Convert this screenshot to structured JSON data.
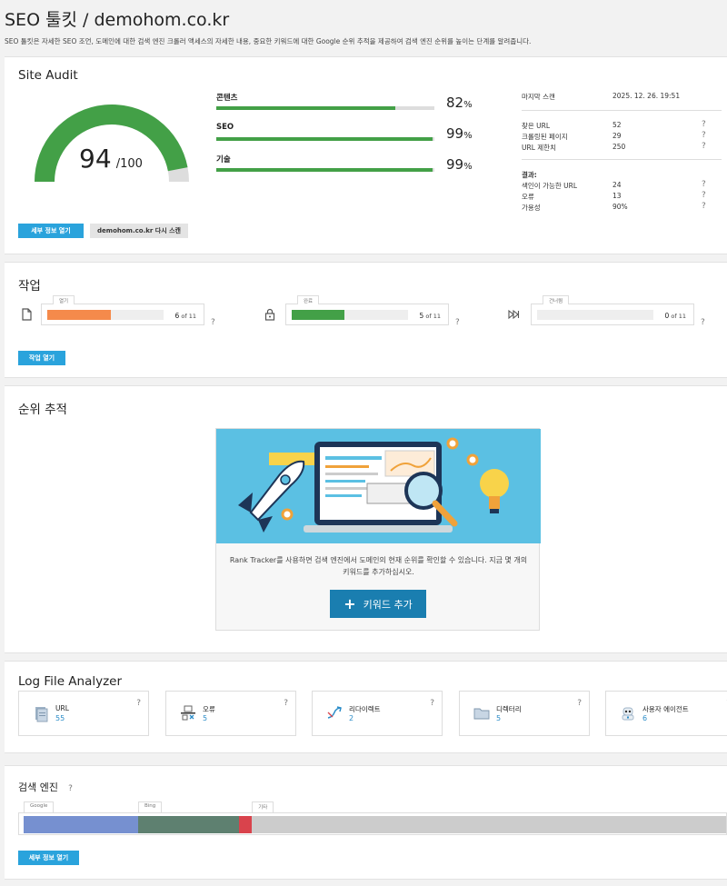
{
  "header": {
    "title": "SEO 툴킷 / demohom.co.kr",
    "description": "SEO 툴킷은 자세한 SEO 조언, 도메인에 대한 검색 엔진 크롤러 액세스의 자세한 내용, 중요한 키워드에 대한 Google 순위 추적을 제공하여 검색 엔진 순위를 높이는 단계를 알려줍니다."
  },
  "site_audit": {
    "title": "Site Audit",
    "score": "94",
    "score_max": "/100",
    "score_value": 94,
    "metrics": [
      {
        "label": "콘텐츠",
        "value": "82",
        "pct": "%",
        "fill": 82
      },
      {
        "label": "SEO",
        "value": "99",
        "pct": "%",
        "fill": 99
      },
      {
        "label": "기술",
        "value": "99",
        "pct": "%",
        "fill": 99
      }
    ],
    "last_scan_label": "마지막 스캔",
    "last_scan_value": "2025. 12. 26. 19:51",
    "stats": [
      {
        "label": "찾은 URL",
        "value": "52",
        "q": "?"
      },
      {
        "label": "크롤링된 페이지",
        "value": "29",
        "q": "?"
      },
      {
        "label": "URL 제한치",
        "value": "250",
        "q": "?"
      }
    ],
    "results_label": "결과:",
    "results": [
      {
        "label": "색인이 가능한 URL",
        "value": "24",
        "q": "?"
      },
      {
        "label": "오류",
        "value": "13",
        "q": "?"
      },
      {
        "label": "가용성",
        "value": "90%",
        "q": "?"
      }
    ],
    "details_button": "세부 정보 열기",
    "rescan_button": "demohom.co.kr 다시 스캔"
  },
  "tasks": {
    "title": "작업",
    "items": [
      {
        "tag": "열기",
        "count": "6",
        "of": "of 11",
        "fill": 0.545,
        "color": "#f58a4b",
        "q": "?"
      },
      {
        "tag": "완료",
        "count": "5",
        "of": "of 11",
        "fill": 0.455,
        "color": "#43a047",
        "q": "?"
      },
      {
        "tag": "건너뜀",
        "count": "0",
        "of": "of 11",
        "fill": 0,
        "color": "#bbbbbb",
        "q": "?"
      }
    ],
    "open_button": "작업 열기"
  },
  "rank_tracking": {
    "title": "순위 추적",
    "description": "Rank Tracker를 사용하면 검색 엔진에서 도메인의 현재 순위를 확인할 수 있습니다. 지금 몇 개의 키워드를 추가하십시오.",
    "add_button_icon": "+",
    "add_button": "키워드 추가"
  },
  "log_file": {
    "title": "Log File Analyzer",
    "items": [
      {
        "label": "URL",
        "value": "55",
        "icon": "document-icon",
        "q": "?"
      },
      {
        "label": "오류",
        "value": "5",
        "icon": "error-icon",
        "q": "?"
      },
      {
        "label": "리다이렉트",
        "value": "2",
        "icon": "redirect-icon",
        "q": "?"
      },
      {
        "label": "디렉터리",
        "value": "5",
        "icon": "folder-icon",
        "q": "?"
      },
      {
        "label": "사용자 에이전트",
        "value": "6",
        "icon": "robot-icon",
        "q": "?"
      }
    ]
  },
  "search_engines": {
    "title": "검색 엔진",
    "q": "?",
    "segments": [
      {
        "label": "Google",
        "share": 0.163,
        "color": "#7690d0"
      },
      {
        "label": "Bing",
        "share": 0.144,
        "color": "#5e8070"
      },
      {
        "label": "",
        "share": 0.018,
        "color": "#d9434c"
      },
      {
        "label": "기타",
        "share": 0.675,
        "color": "#cccccc"
      }
    ],
    "details_button": "세부 정보 열기"
  },
  "colors": {
    "accent": "#2aa3dc",
    "green": "#43a047",
    "orange": "#f58a4b",
    "rank_button": "#1a7eb0",
    "rank_banner": "#5bc0e3"
  }
}
